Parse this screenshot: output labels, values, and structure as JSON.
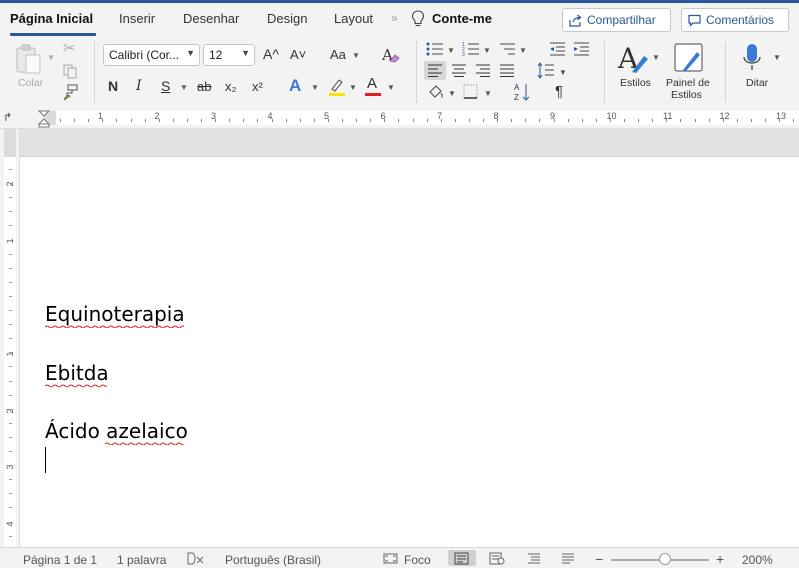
{
  "tabs": {
    "items": [
      {
        "label": "Página Inicial",
        "active": true
      },
      {
        "label": "Inserir"
      },
      {
        "label": "Desenhar"
      },
      {
        "label": "Design"
      },
      {
        "label": "Layout"
      },
      {
        "label": "Conte-me"
      }
    ],
    "share_label": "Compartilhar",
    "comments_label": "Comentários"
  },
  "ribbon": {
    "paste_label": "Colar",
    "font_name": "Calibri (Cor...",
    "font_size": "12",
    "grow_font": "A^",
    "shrink_font": "A˅",
    "change_case": "Aa",
    "bold": "N",
    "italic": "I",
    "underline": "S",
    "strikethrough": "ab",
    "subscript": "x₂",
    "superscript": "x²",
    "text_effects": "A",
    "font_color": "A",
    "pilcrow": "¶",
    "styles_label": "Estilos",
    "styles_pane_label_1": "Painel de",
    "styles_pane_label_2": "Estilos",
    "dictate_label": "Ditar",
    "font_color_hex": "#e02020",
    "highlight_color_hex": "#f5e500",
    "accent_hex": "#2b579a",
    "text_effects_hex": "#3a7bd5"
  },
  "ruler": {
    "marks": [
      "1",
      "2",
      "3",
      "4",
      "5",
      "6",
      "7",
      "8",
      "9",
      "10",
      "11",
      "12",
      "13"
    ]
  },
  "vruler": {
    "marks": [
      "2",
      "1",
      "1",
      "2",
      "3",
      "4"
    ]
  },
  "document": {
    "lines": [
      "Equinoterapia",
      "Ebitda",
      "Ácido azelaico"
    ]
  },
  "status": {
    "page": "Página 1 de 1",
    "words": "1 palavra",
    "language": "Português (Brasil)",
    "focus": "Foco",
    "zoom_minus": "−",
    "zoom_plus": "+",
    "zoom": "200%",
    "zoom_fraction": 0.55
  }
}
